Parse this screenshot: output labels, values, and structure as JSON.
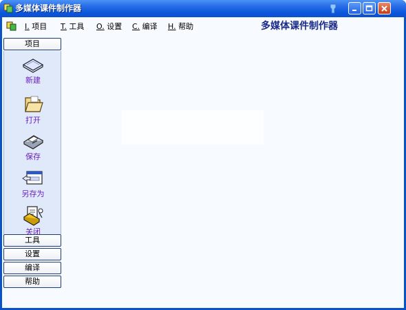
{
  "window": {
    "title": "多媒体课件制作器",
    "accent": "#0a52c8"
  },
  "menubar": {
    "items": [
      {
        "key": "I.",
        "label": " 项目"
      },
      {
        "key": "T.",
        "label": " 工具"
      },
      {
        "key": "O.",
        "label": " 设置"
      },
      {
        "key": "C.",
        "label": " 编译"
      },
      {
        "key": "H.",
        "label": " 帮助"
      }
    ],
    "brand": "多媒体课件制作器"
  },
  "leftpanel": {
    "sections": [
      {
        "label": "项目"
      },
      {
        "label": "工具"
      },
      {
        "label": "设置"
      },
      {
        "label": "编译"
      },
      {
        "label": "帮助"
      }
    ],
    "tools": [
      {
        "label": "新建",
        "icon": "new-icon"
      },
      {
        "label": "打开",
        "icon": "open-folder-icon"
      },
      {
        "label": "保存",
        "icon": "save-icon"
      },
      {
        "label": "另存为",
        "icon": "save-as-icon"
      },
      {
        "label": "关闭",
        "icon": "close-document-icon"
      }
    ],
    "label_color": "#6c1fbf"
  }
}
